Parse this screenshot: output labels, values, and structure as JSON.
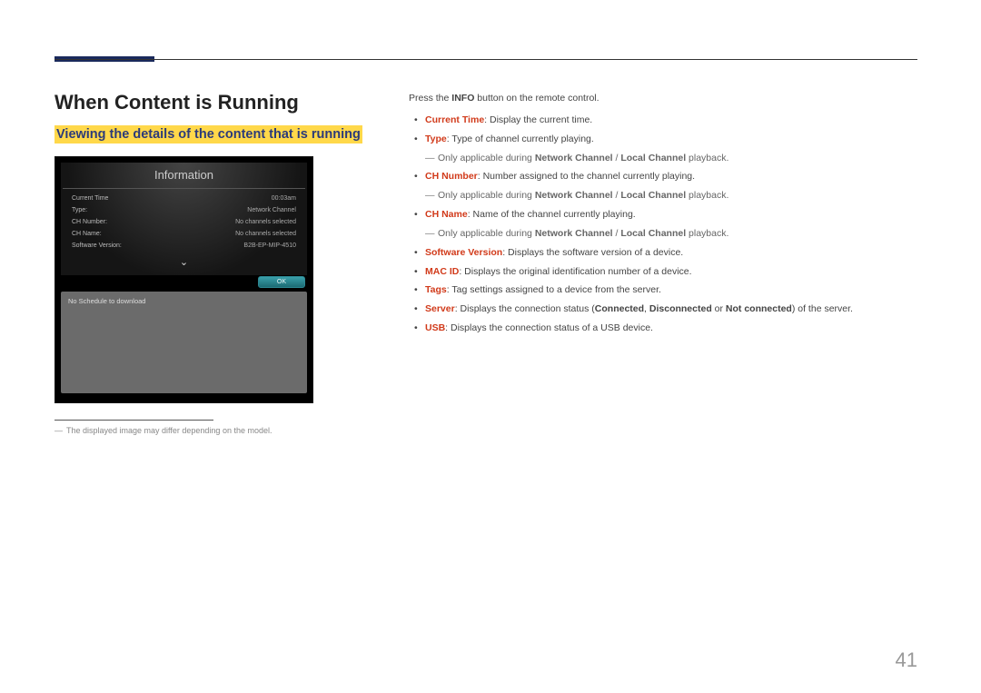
{
  "heading1": "When Content is Running",
  "heading2": "Viewing the details of the content that is running",
  "infoPanel": {
    "title": "Information",
    "rows": [
      {
        "label": "Current Time",
        "value": "00:03am"
      },
      {
        "label": "Type:",
        "value": "Network Channel"
      },
      {
        "label": "CH Number:",
        "value": "No channels selected"
      },
      {
        "label": "CH Name:",
        "value": "No channels selected"
      },
      {
        "label": "Software Version:",
        "value": "B2B-EP-MIP-4510"
      }
    ],
    "okLabel": "OK",
    "lowerMsg": "No Schedule to download"
  },
  "caption": "The displayed image may differ depending on the model.",
  "intro": {
    "pre": "Press the ",
    "bold": "INFO",
    "post": " button on the remote control."
  },
  "bullets": [
    {
      "type": "bullet",
      "label": "Current Time",
      "labelRed": true,
      "text": ": Display the current time."
    },
    {
      "type": "bullet",
      "label": "Type",
      "labelRed": true,
      "text": ": Type of channel currently playing."
    },
    {
      "type": "sub",
      "pre": "Only applicable during ",
      "b1": "Network Channel",
      "mid": " / ",
      "b2": "Local Channel",
      "post": " playback."
    },
    {
      "type": "bullet",
      "label": "CH Number",
      "labelRed": true,
      "text": ": Number assigned to the channel currently playing."
    },
    {
      "type": "sub",
      "pre": "Only applicable during ",
      "b1": "Network Channel",
      "mid": " / ",
      "b2": "Local Channel",
      "post": " playback."
    },
    {
      "type": "bullet",
      "label": "CH Name",
      "labelRed": true,
      "text": ": Name of the channel currently playing."
    },
    {
      "type": "sub",
      "pre": "Only applicable during ",
      "b1": "Network Channel",
      "mid": " / ",
      "b2": "Local Channel",
      "post": " playback."
    },
    {
      "type": "bullet",
      "label": "Software Version",
      "labelRed": true,
      "text": ": Displays the software version of a device."
    },
    {
      "type": "bullet",
      "label": "MAC ID",
      "labelRed": true,
      "text": ": Displays the original identification number of a device."
    },
    {
      "type": "bullet",
      "label": "Tags",
      "labelRed": true,
      "text": ": Tag settings assigned to a device from the server."
    },
    {
      "type": "bullet",
      "label": "Server",
      "labelRed": true,
      "text_pre": ": Displays the connection status (",
      "status": [
        "Connected",
        "Disconnected",
        "Not connected"
      ],
      "joins": [
        ", ",
        " or "
      ],
      "text_post": ") of the server."
    },
    {
      "type": "bullet",
      "label": "USB",
      "labelRed": true,
      "text": ": Displays the connection status of a USB device."
    }
  ],
  "pageNumber": "41"
}
